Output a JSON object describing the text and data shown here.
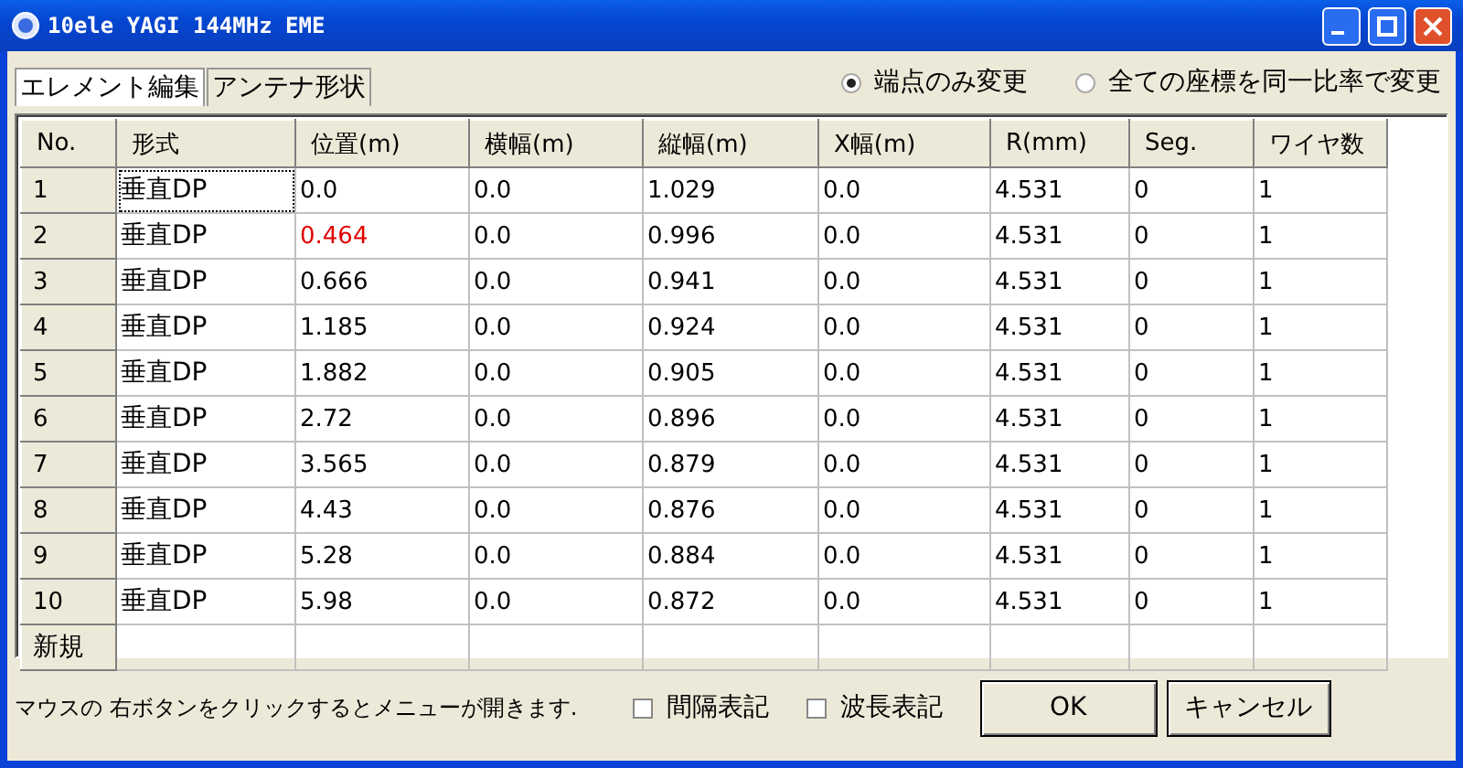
{
  "window": {
    "title": "10ele YAGI 144MHz EME"
  },
  "tabs": [
    {
      "label": "エレメント編集",
      "selected": true
    },
    {
      "label": "アンテナ形状",
      "selected": false
    }
  ],
  "scale_mode": [
    {
      "label": "端点のみ変更",
      "selected": true
    },
    {
      "label": "全ての座標を同一比率で変更",
      "selected": false
    }
  ],
  "table": {
    "columns": [
      "No.",
      "形式",
      "位置(m)",
      "横幅(m)",
      "縦幅(m)",
      "X幅(m)",
      "R(mm)",
      "Seg.",
      "ワイヤ数"
    ],
    "rows": [
      {
        "cells": [
          "1",
          "垂直DP",
          "0.0",
          "0.0",
          "1.029",
          "0.0",
          "4.531",
          "0",
          "1"
        ],
        "focused": true,
        "modified": false
      },
      {
        "cells": [
          "2",
          "垂直DP",
          "0.464",
          "0.0",
          "0.996",
          "0.0",
          "4.531",
          "0",
          "1"
        ],
        "focused": false,
        "modified": true
      },
      {
        "cells": [
          "3",
          "垂直DP",
          "0.666",
          "0.0",
          "0.941",
          "0.0",
          "4.531",
          "0",
          "1"
        ],
        "focused": false,
        "modified": false
      },
      {
        "cells": [
          "4",
          "垂直DP",
          "1.185",
          "0.0",
          "0.924",
          "0.0",
          "4.531",
          "0",
          "1"
        ],
        "focused": false,
        "modified": false
      },
      {
        "cells": [
          "5",
          "垂直DP",
          "1.882",
          "0.0",
          "0.905",
          "0.0",
          "4.531",
          "0",
          "1"
        ],
        "focused": false,
        "modified": false
      },
      {
        "cells": [
          "6",
          "垂直DP",
          "2.72",
          "0.0",
          "0.896",
          "0.0",
          "4.531",
          "0",
          "1"
        ],
        "focused": false,
        "modified": false
      },
      {
        "cells": [
          "7",
          "垂直DP",
          "3.565",
          "0.0",
          "0.879",
          "0.0",
          "4.531",
          "0",
          "1"
        ],
        "focused": false,
        "modified": false
      },
      {
        "cells": [
          "8",
          "垂直DP",
          "4.43",
          "0.0",
          "0.876",
          "0.0",
          "4.531",
          "0",
          "1"
        ],
        "focused": false,
        "modified": false
      },
      {
        "cells": [
          "9",
          "垂直DP",
          "5.28",
          "0.0",
          "0.884",
          "0.0",
          "4.531",
          "0",
          "1"
        ],
        "focused": false,
        "modified": false
      },
      {
        "cells": [
          "10",
          "垂直DP",
          "5.98",
          "0.0",
          "0.872",
          "0.0",
          "4.531",
          "0",
          "1"
        ],
        "focused": false,
        "modified": false
      }
    ],
    "new_row": "新規"
  },
  "status_text": "マウスの 右ボタンをクリックするとメニューが開きます.",
  "options": [
    {
      "label": "間隔表記",
      "checked": false
    },
    {
      "label": "波長表記",
      "checked": false
    }
  ],
  "buttons": [
    "OK",
    "キャンセル"
  ]
}
